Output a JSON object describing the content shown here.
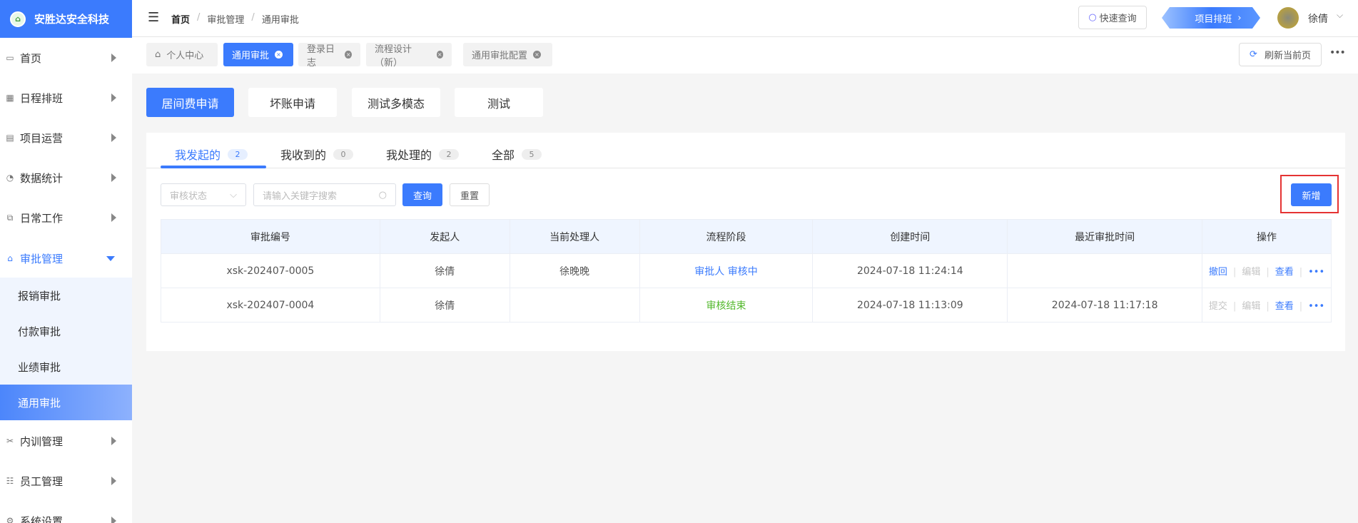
{
  "app": {
    "name": "安胜达安全科技"
  },
  "sidebar": {
    "items": [
      {
        "label": "首页",
        "icon": "monitor-icon"
      },
      {
        "label": "日程排班",
        "icon": "calendar-icon"
      },
      {
        "label": "项目运营",
        "icon": "grid-icon"
      },
      {
        "label": "数据统计",
        "icon": "pie-icon"
      },
      {
        "label": "日常工作",
        "icon": "copy-icon"
      },
      {
        "label": "审批管理",
        "icon": "lock-icon"
      },
      {
        "label": "内训管理",
        "icon": "tools-icon"
      },
      {
        "label": "员工管理",
        "icon": "list-icon"
      },
      {
        "label": "系统设置",
        "icon": "gear-icon"
      }
    ],
    "sub": [
      "报销审批",
      "付款审批",
      "业绩审批",
      "通用审批"
    ]
  },
  "header": {
    "breadcrumb": [
      "首页",
      "审批管理",
      "通用审批"
    ],
    "quick_search": "快速查询",
    "schedule": "项目排班",
    "user": "徐倩"
  },
  "tags": [
    "个人中心",
    "通用审批",
    "登录日志",
    "流程设计（新）",
    "通用审批配置"
  ],
  "refresh": "刷新当前页",
  "types": [
    "居间费申请",
    "坏账申请",
    "测试多模态",
    "测试"
  ],
  "tabs": [
    {
      "label": "我发起的",
      "count": "2"
    },
    {
      "label": "我收到的",
      "count": "0"
    },
    {
      "label": "我处理的",
      "count": "2"
    },
    {
      "label": "全部",
      "count": "5"
    }
  ],
  "filter": {
    "status_placeholder": "审核状态",
    "search_placeholder": "请输入关键字搜索",
    "query": "查询",
    "reset": "重置",
    "add": "新增"
  },
  "table": {
    "headers": [
      "审批编号",
      "发起人",
      "当前处理人",
      "流程阶段",
      "创建时间",
      "最近审批时间",
      "操作"
    ],
    "rows": [
      {
        "id": "xsk-202407-0005",
        "initiator": "徐倩",
        "handler": "徐晚晚",
        "stage": "审批人 审核中",
        "created": "2024-07-18 11:24:14",
        "last": "",
        "ops": [
          "撤回",
          "编辑",
          "查看"
        ]
      },
      {
        "id": "xsk-202407-0004",
        "initiator": "徐倩",
        "handler": "",
        "stage": "审核结束",
        "created": "2024-07-18 11:13:09",
        "last": "2024-07-18 11:17:18",
        "ops": [
          "提交",
          "编辑",
          "查看"
        ]
      }
    ]
  }
}
